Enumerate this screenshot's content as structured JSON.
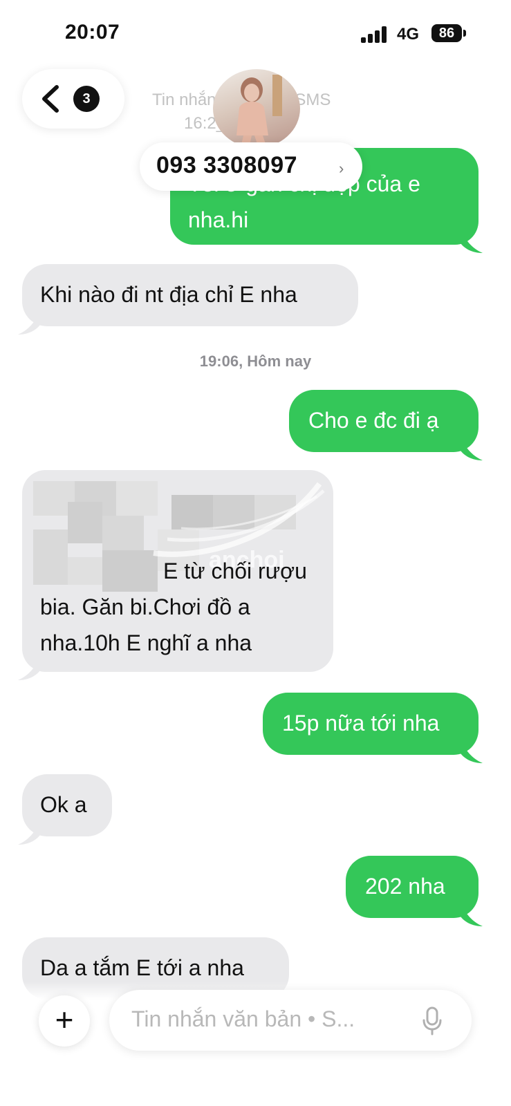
{
  "status_bar": {
    "time": "20:07",
    "network": "4G",
    "battery": "86"
  },
  "header": {
    "back_count": "3",
    "conversation_subtitle_line1": "Tin nhắn văn bản • SMS",
    "conversation_subtitle_line2": "16:2_ Hôm nay",
    "contact_number": "093 3308097",
    "contact_chevron": "›"
  },
  "messages": [
    {
      "direction": "out",
      "text_line1": "Tôi ở gần chị đẹp của e",
      "text_line2": "nha.hi"
    },
    {
      "direction": "in",
      "text": "Khi nào đi nt địa chỉ E nha"
    },
    {
      "type": "timestamp",
      "text": "19:06, Hôm nay"
    },
    {
      "direction": "out",
      "text": "Cho e đc đi ạ"
    },
    {
      "direction": "in",
      "text_line1": "E từ chối rượu",
      "text_line2": "bia. Găn bi.Chơi đồ a",
      "text_line3": "nha.10h E nghĩ a nha",
      "watermark": "anchoi"
    },
    {
      "direction": "out",
      "text": "15p nữa tới nha"
    },
    {
      "direction": "in",
      "text": "Ok a"
    },
    {
      "direction": "out",
      "text": "202 nha"
    },
    {
      "direction": "in",
      "text": "Da a tắm E tới a nha"
    }
  ],
  "composer": {
    "plus_label": "+",
    "placeholder": "Tin nhắn văn bản • S...",
    "mic_icon": "microphone-icon"
  },
  "colors": {
    "incoming": "#e9e9eb",
    "outgoing": "#34c759"
  }
}
